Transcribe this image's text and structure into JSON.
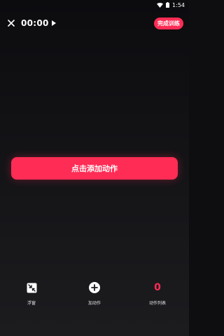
{
  "colors": {
    "accent": "#ff2c55",
    "background": "#0e0e11"
  },
  "status_bar": {
    "time": "1:54",
    "icons": [
      "wifi-icon",
      "battery-icon"
    ]
  },
  "top_bar": {
    "close_icon": "close-icon",
    "timer": "00:00",
    "play_icon": "play-icon",
    "finish_label": "完成训练"
  },
  "main": {
    "add_action_label": "点击添加动作"
  },
  "bottom_nav": {
    "float": {
      "icon": "float-window-icon",
      "label": "浮窗"
    },
    "add": {
      "icon": "plus-circle-icon",
      "label": "加动作"
    },
    "list": {
      "count": "0",
      "label": "动作列表"
    }
  }
}
